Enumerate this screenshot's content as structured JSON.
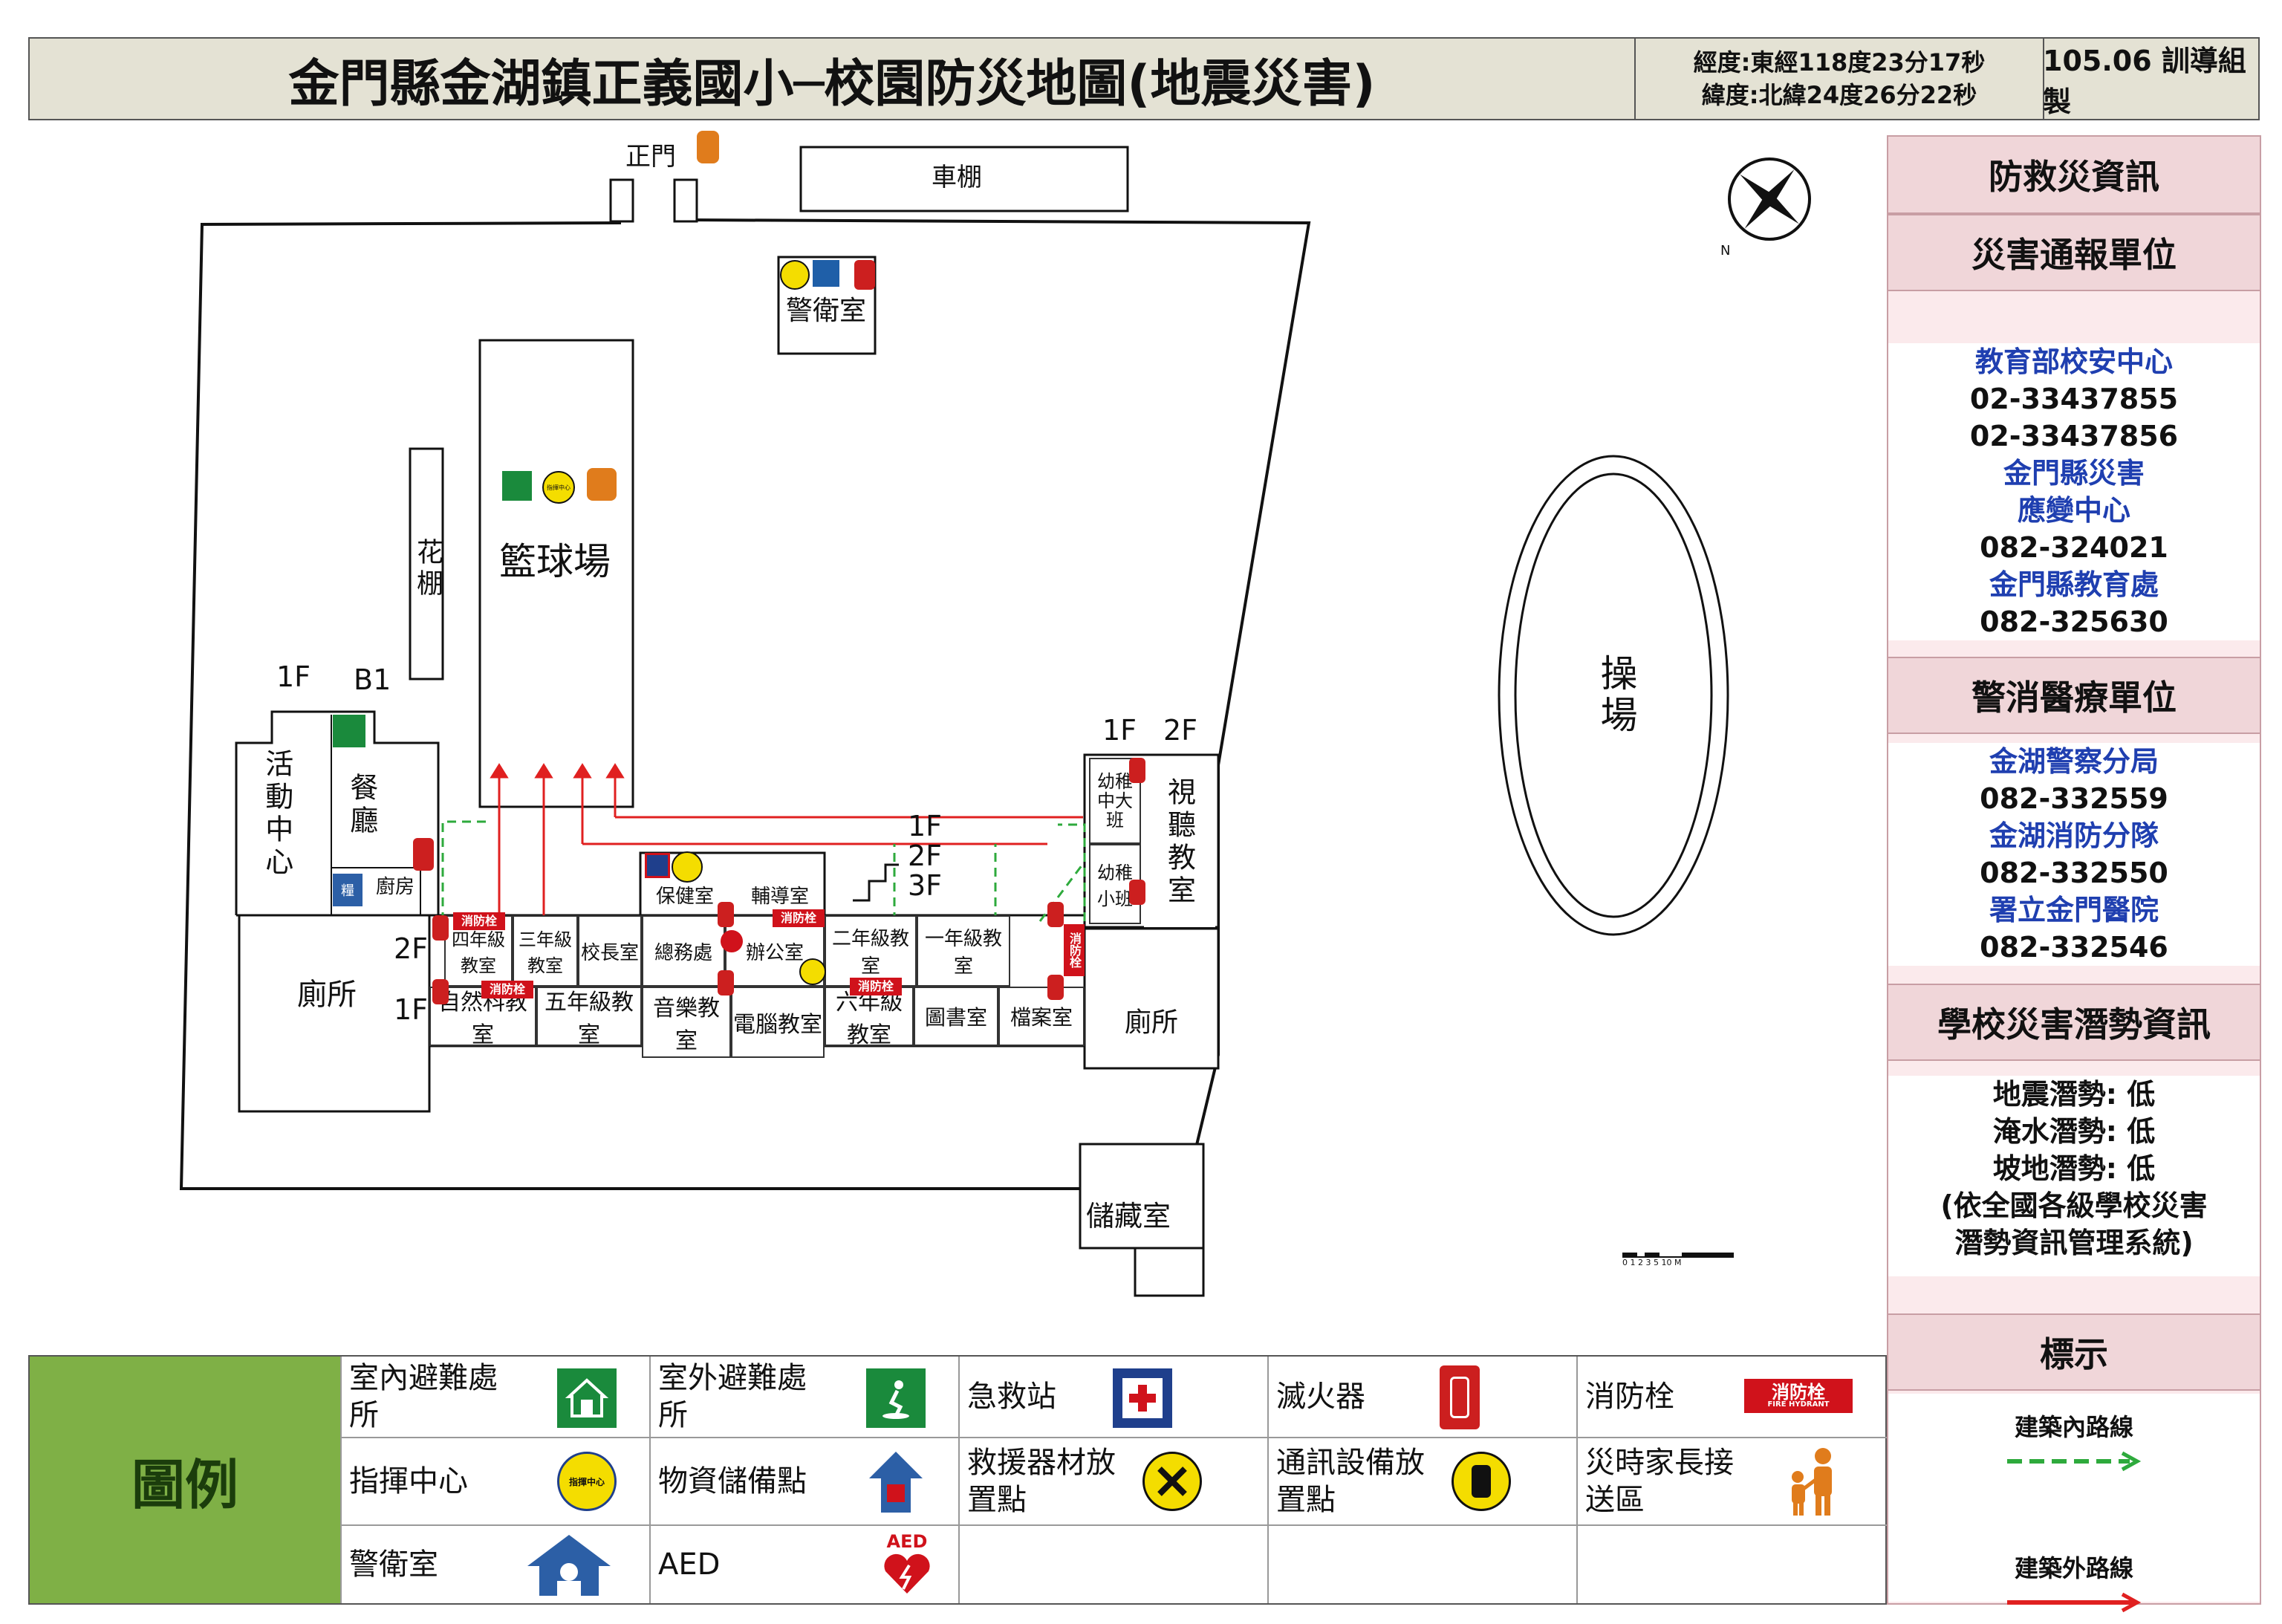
{
  "header": {
    "title": "金門縣金湖鎮正義國小─校園防災地圖(地震災害)",
    "longitude": "經度:東經118度23分17秒",
    "latitude": "緯度:北緯24度26分22秒",
    "org": "105.06 訓導組製"
  },
  "map": {
    "main_gate": "正門",
    "bike_shed": "車棚",
    "guard_room": "警衛室",
    "basketball_court": "籃球場",
    "flower_shed": "花棚",
    "playground": "操場",
    "activity_center": "活動中心",
    "dining_hall": "餐廳",
    "kitchen": "廚房",
    "toilet_left": "廁所",
    "toilet_right": "廁所",
    "storage": "儲藏室",
    "floor_1f_left": "1F",
    "floor_b1": "B1",
    "floor_1f_right": "1F",
    "floor_2f_right": "2F",
    "floor_2f_mid": "2F",
    "floor_1f_mid": "1F",
    "stair_1f": "1F",
    "stair_2f": "2F",
    "stair_3f": "3F",
    "rooms": {
      "kinder_big": "幼稚中大班",
      "kinder_small": "幼稚小班",
      "av_room": "視聽教室",
      "health_room": "保健室",
      "counsel_room": "輔導室",
      "grade4": "四年級教室",
      "grade3": "三年級教室",
      "principal": "校長室",
      "general_affairs": "總務處",
      "office": "辦公室",
      "grade2": "二年級教室",
      "grade1": "一年級教室",
      "science": "自然科教室",
      "grade5": "五年級教室",
      "music": "音樂教室",
      "computer": "電腦教室",
      "grade6": "六年級教室",
      "library": "圖書室",
      "archive": "檔案室"
    },
    "hydrant_text": "消防栓",
    "hydrant_sub": "FIRE HYDRANT",
    "command_text": "指揮中心",
    "supply_text": "糧",
    "scale_label": "0 1 2 3  5        10 M"
  },
  "panel": {
    "title": "防救災資訊",
    "report_header": "災害通報單位",
    "report_lines": [
      {
        "text": "教育部校安中心",
        "blue": true
      },
      {
        "text": "02-33437855",
        "blue": false
      },
      {
        "text": "02-33437856",
        "blue": false
      },
      {
        "text": "金門縣災害",
        "blue": true
      },
      {
        "text": "應變中心",
        "blue": true
      },
      {
        "text": "082-324021",
        "blue": false
      },
      {
        "text": "金門縣教育處",
        "blue": true
      },
      {
        "text": "082-325630",
        "blue": false
      }
    ],
    "police_header": "警消醫療單位",
    "police_lines": [
      {
        "text": "金湖警察分局",
        "blue": true
      },
      {
        "text": "082-332559",
        "blue": false
      },
      {
        "text": "金湖消防分隊",
        "blue": true
      },
      {
        "text": "082-332550",
        "blue": false
      },
      {
        "text": "署立金門醫院",
        "blue": true
      },
      {
        "text": "082-332546",
        "blue": false
      }
    ],
    "risk_header": "學校災害潛勢資訊",
    "risk_lines": [
      "地震潛勢: 低",
      "淹水潛勢: 低",
      "坡地潛勢: 低",
      "(依全國各級學校災害",
      "潛勢資訊管理系統)"
    ],
    "sign_header": "標示",
    "inside_route": "建築內路線",
    "outside_route": "建築外路線",
    "inside_color": "#2eaa3c",
    "outside_color": "#e02020"
  },
  "legend": {
    "title": "圖例",
    "items": [
      {
        "label": "室內避難處所",
        "icon": "indoor-shelter-icon"
      },
      {
        "label": "室外避難處所",
        "icon": "outdoor-shelter-icon"
      },
      {
        "label": "急救站",
        "icon": "first-aid-icon"
      },
      {
        "label": "滅火器",
        "icon": "fire-extinguisher-icon"
      },
      {
        "label": "消防栓",
        "icon": "fire-hydrant-icon"
      },
      {
        "label": "指揮中心",
        "icon": "command-center-icon"
      },
      {
        "label": "物資儲備點",
        "icon": "supply-point-icon"
      },
      {
        "label": "救援器材放置點",
        "icon": "rescue-equipment-icon"
      },
      {
        "label": "通訊設備放置點",
        "icon": "communication-icon"
      },
      {
        "label": "災時家長接送區",
        "icon": "parent-pickup-icon"
      },
      {
        "label": "警衛室",
        "icon": "guard-room-icon"
      },
      {
        "label": "AED",
        "icon": "aed-icon"
      }
    ]
  }
}
